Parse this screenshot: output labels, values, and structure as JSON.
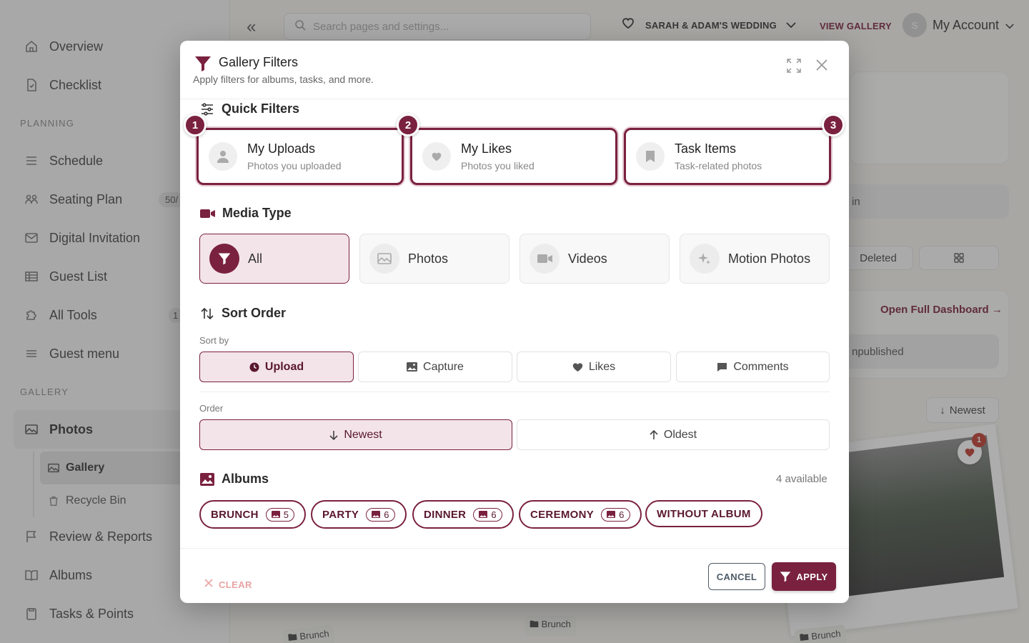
{
  "sidebar": {
    "items_top": [
      {
        "label": "Overview",
        "icon": "home-icon"
      },
      {
        "label": "Checklist",
        "icon": "checklist-icon"
      }
    ],
    "planning_label": "PLANNING",
    "planning": [
      {
        "label": "Schedule",
        "icon": "schedule-icon",
        "badge": ""
      },
      {
        "label": "Seating Plan",
        "icon": "seating-icon",
        "badge": "50/"
      },
      {
        "label": "Digital Invitation",
        "icon": "mail-icon",
        "badge": ""
      },
      {
        "label": "Guest List",
        "icon": "list-icon",
        "badge": ""
      },
      {
        "label": "All Tools",
        "icon": "puzzle-icon",
        "badge": "1"
      },
      {
        "label": "Guest menu",
        "icon": "menu-icon",
        "badge": ""
      }
    ],
    "gallery_label": "GALLERY",
    "photos_label": "Photos",
    "gallery_sub": "Gallery",
    "recycle_sub": "Recycle Bin",
    "items_bottom": [
      {
        "label": "Review & Reports",
        "icon": "flag-icon"
      },
      {
        "label": "Albums",
        "icon": "book-icon"
      },
      {
        "label": "Tasks & Points",
        "icon": "clipboard-icon"
      }
    ]
  },
  "topbar": {
    "search_placeholder": "Search pages and settings...",
    "event_name": "SARAH & ADAM'S WEDDING",
    "view_gallery": "VIEW GALLERY",
    "avatar_letter": "S",
    "account_label": "My Account"
  },
  "background": {
    "in_text": "in",
    "deleted": "Deleted",
    "open_dashboard": "Open Full Dashboard →",
    "unpublished": "npublished",
    "newest": "Newest",
    "heart_count": "1",
    "tags": [
      "Brunch",
      "Brunch",
      "Brunch"
    ]
  },
  "modal": {
    "title": "Gallery Filters",
    "subtitle": "Apply filters for albums, tasks, and more.",
    "quick_filters": {
      "title": "Quick Filters",
      "items": [
        {
          "num": "1",
          "title": "My Uploads",
          "sub": "Photos you uploaded"
        },
        {
          "num": "2",
          "title": "My Likes",
          "sub": "Photos you liked"
        },
        {
          "num": "3",
          "title": "Task Items",
          "sub": "Task-related photos"
        }
      ]
    },
    "media_type": {
      "title": "Media Type",
      "items": [
        "All",
        "Photos",
        "Videos",
        "Motion Photos"
      ],
      "selected": "All"
    },
    "sort_order": {
      "title": "Sort Order",
      "sort_by_label": "Sort by",
      "sort_by": [
        "Upload",
        "Capture",
        "Likes",
        "Comments"
      ],
      "sort_selected": "Upload",
      "order_label": "Order",
      "order": [
        "Newest",
        "Oldest"
      ],
      "order_selected": "Newest"
    },
    "albums": {
      "title": "Albums",
      "available": "4 available",
      "items": [
        {
          "name": "BRUNCH",
          "count": "5"
        },
        {
          "name": "PARTY",
          "count": "6"
        },
        {
          "name": "DINNER",
          "count": "6"
        },
        {
          "name": "CEREMONY",
          "count": "6"
        },
        {
          "name": "WITHOUT ALBUM",
          "count": ""
        }
      ]
    },
    "footer": {
      "clear": "CLEAR",
      "cancel": "CANCEL",
      "apply": "APPLY"
    }
  },
  "colors": {
    "accent": "#7a2140",
    "accent_light": "#f3e4e9",
    "clear": "#e9a3a3"
  }
}
